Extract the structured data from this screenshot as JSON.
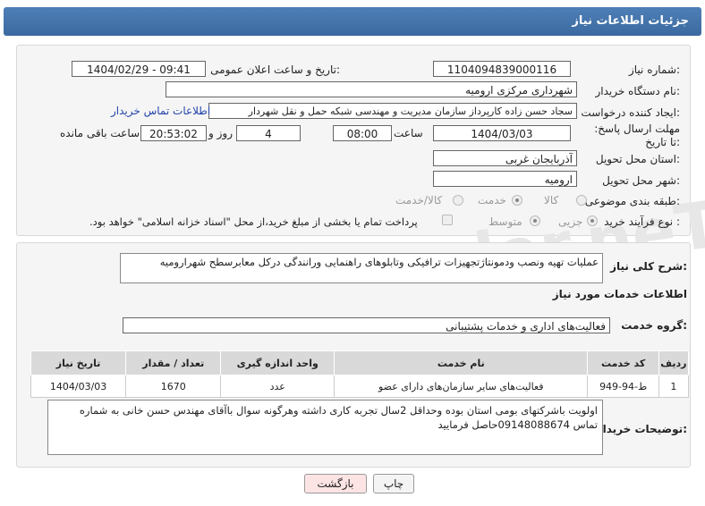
{
  "header": {
    "title": "جزئیات اطلاعات نیاز"
  },
  "watermark": "AriaTender.neT",
  "fields": {
    "need_number_label": "شماره نیاز:",
    "need_number": "1104094839000116",
    "announce_label": "تاریخ و ساعت اعلان عمومی:",
    "announce_value": "1404/02/29 - 09:41",
    "buyer_org_label": "نام دستگاه خریدار:",
    "buyer_org": "شهرداری مرکزی ارومیه",
    "requester_label": "ایجاد کننده درخواست:",
    "requester": "سجاد حسن زاده کارپرداز سازمان مدیریت و مهندسی شبکه حمل و نقل شهردار",
    "contact_link": "اطلاعات تماس خریدار",
    "deadline_label": "مهلت ارسال پاسخ: تا تاریخ:",
    "deadline_date": "1404/03/03",
    "time_label": "ساعت",
    "deadline_time": "08:00",
    "days": "4",
    "days_label": "روز و",
    "remaining_time": "20:53:02",
    "remaining_label": "ساعت باقی مانده",
    "province_label": "استان محل تحویل:",
    "province": "آذربایجان غربی",
    "city_label": "شهر محل تحویل:",
    "city": "ارومیه",
    "category_label": "طبقه بندی موضوعی:",
    "category_options": [
      "کالا",
      "خدمت",
      "کالا/خدمت"
    ],
    "category_selected": "خدمت",
    "process_label": "نوع فرآیند خرید :",
    "process_options": [
      "جزیی",
      "متوسط"
    ],
    "process_selected": "جزیی",
    "payment_note": "پرداخت تمام یا بخشی از مبلغ خرید،از محل \"اسناد خزانه اسلامی\" خواهد بود."
  },
  "description": {
    "label": "شرح کلی نیاز:",
    "text": "عملیات تهیه ونصب ودمونتاژتجهیزات ترافیکی وتابلوهای راهنمایی ورانندگی درکل معابرسطح شهرارومیه"
  },
  "services": {
    "section_title": "اطلاعات خدمات مورد نیاز",
    "group_label": "گروه خدمت:",
    "group_value": "فعالیت‌های اداری و خدمات پشتیبانی",
    "columns": [
      "ردیف",
      "کد خدمت",
      "نام خدمت",
      "واحد اندازه گیری",
      "تعداد / مقدار",
      "تاریخ نیاز"
    ],
    "rows": [
      {
        "index": "1",
        "code": "ط-94-949",
        "name": "فعالیت‌های سایر سازمان‌های دارای عضو",
        "unit": "عدد",
        "qty": "1670",
        "date": "1404/03/03"
      }
    ]
  },
  "buyer_notes": {
    "label": "توضیحات خریدار:",
    "text": "اولویت باشرکتهای بومی استان بوده وحداقل 2سال تجربه کاری داشته وهرگونه سوال باآقای مهندس حسن خانی به شماره تماس 09148088674حاصل فرمایید"
  },
  "buttons": {
    "print": "چاپ",
    "back": "بازگشت"
  }
}
